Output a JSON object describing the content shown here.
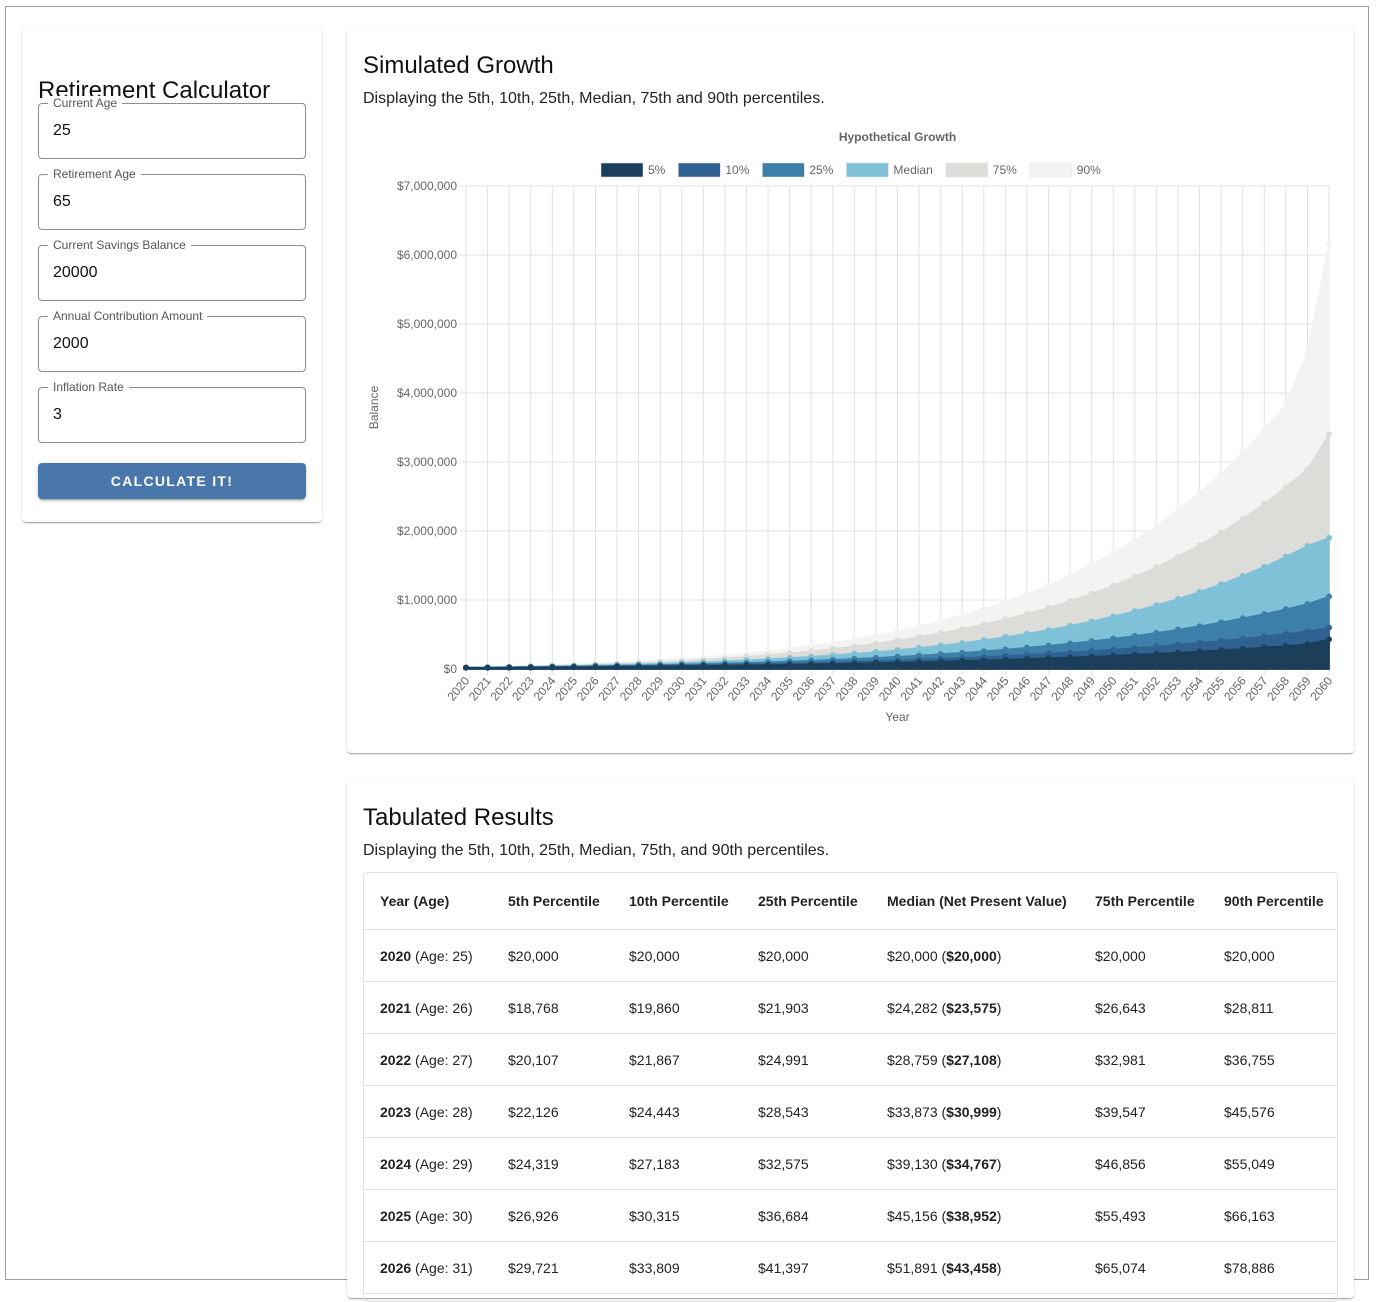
{
  "form": {
    "title": "Retirement Calculator",
    "fields": [
      {
        "label": "Current Age",
        "value": "25"
      },
      {
        "label": "Retirement Age",
        "value": "65"
      },
      {
        "label": "Current Savings Balance",
        "value": "20000"
      },
      {
        "label": "Annual Contribution Amount",
        "value": "2000"
      },
      {
        "label": "Inflation Rate",
        "value": "3"
      }
    ],
    "button_label": "CALCULATE IT!"
  },
  "growth": {
    "title": "Simulated Growth",
    "subtitle": "Displaying the 5th, 10th, 25th, Median, 75th and 90th percentiles."
  },
  "results": {
    "title": "Tabulated Results",
    "subtitle": "Displaying the 5th, 10th, 25th, Median, 75th, and 90th percentiles.",
    "columns": [
      "Year (Age)",
      "5th Percentile",
      "10th Percentile",
      "25th Percentile",
      "Median (Net Present Value)",
      "75th Percentile",
      "90th Percentile"
    ],
    "rows": [
      {
        "year": "2020",
        "age": "(Age: 25)",
        "p5": "$20,000",
        "p10": "$20,000",
        "p25": "$20,000",
        "median": "$20,000",
        "npv": "$20,000",
        "p75": "$20,000",
        "p90": "$20,000"
      },
      {
        "year": "2021",
        "age": "(Age: 26)",
        "p5": "$18,768",
        "p10": "$19,860",
        "p25": "$21,903",
        "median": "$24,282",
        "npv": "$23,575",
        "p75": "$26,643",
        "p90": "$28,811"
      },
      {
        "year": "2022",
        "age": "(Age: 27)",
        "p5": "$20,107",
        "p10": "$21,867",
        "p25": "$24,991",
        "median": "$28,759",
        "npv": "$27,108",
        "p75": "$32,981",
        "p90": "$36,755"
      },
      {
        "year": "2023",
        "age": "(Age: 28)",
        "p5": "$22,126",
        "p10": "$24,443",
        "p25": "$28,543",
        "median": "$33,873",
        "npv": "$30,999",
        "p75": "$39,547",
        "p90": "$45,576"
      },
      {
        "year": "2024",
        "age": "(Age: 29)",
        "p5": "$24,319",
        "p10": "$27,183",
        "p25": "$32,575",
        "median": "$39,130",
        "npv": "$34,767",
        "p75": "$46,856",
        "p90": "$55,049"
      },
      {
        "year": "2025",
        "age": "(Age: 30)",
        "p5": "$26,926",
        "p10": "$30,315",
        "p25": "$36,684",
        "median": "$45,156",
        "npv": "$38,952",
        "p75": "$55,493",
        "p90": "$66,163"
      },
      {
        "year": "2026",
        "age": "(Age: 31)",
        "p5": "$29,721",
        "p10": "$33,809",
        "p25": "$41,397",
        "median": "$51,891",
        "npv": "$43,458",
        "p75": "$65,074",
        "p90": "$78,886"
      }
    ]
  },
  "chart_data": {
    "type": "area",
    "title": "Hypothetical Growth",
    "xlabel": "Year",
    "ylabel": "Balance",
    "y_ticks": [
      "$0",
      "$1,000,000",
      "$2,000,000",
      "$3,000,000",
      "$4,000,000",
      "$5,000,000",
      "$6,000,000",
      "$7,000,000"
    ],
    "ylim": [
      0,
      7000000
    ],
    "grid": true,
    "legend_position": "top",
    "x": [
      "2020",
      "2021",
      "2022",
      "2023",
      "2024",
      "2025",
      "2026",
      "2027",
      "2028",
      "2029",
      "2030",
      "2031",
      "2032",
      "2033",
      "2034",
      "2035",
      "2036",
      "2037",
      "2038",
      "2039",
      "2040",
      "2041",
      "2042",
      "2043",
      "2044",
      "2045",
      "2046",
      "2047",
      "2048",
      "2049",
      "2050",
      "2051",
      "2052",
      "2053",
      "2054",
      "2055",
      "2056",
      "2057",
      "2058",
      "2059",
      "2060"
    ],
    "series": [
      {
        "name": "5%",
        "color": "#1b3f5a",
        "values": [
          20000,
          18768,
          20107,
          22126,
          24319,
          26926,
          29721,
          32500,
          35500,
          38700,
          42100,
          45800,
          49800,
          54000,
          58600,
          63500,
          68800,
          74400,
          80400,
          86800,
          93700,
          101000,
          109000,
          117000,
          126000,
          136000,
          146000,
          157000,
          168000,
          180000,
          193000,
          207000,
          222000,
          238000,
          255000,
          273000,
          292000,
          312000,
          334000,
          357000,
          430000
        ]
      },
      {
        "name": "10%",
        "color": "#2f6290",
        "values": [
          20000,
          19860,
          21867,
          24443,
          27183,
          30315,
          33809,
          37500,
          41500,
          45800,
          50500,
          55500,
          61000,
          66900,
          73300,
          80200,
          87700,
          95800,
          104500,
          114000,
          124000,
          135000,
          147000,
          160000,
          174000,
          189000,
          205000,
          222000,
          240000,
          260000,
          281000,
          303000,
          327000,
          353000,
          380000,
          409000,
          440000,
          473000,
          508000,
          546000,
          600000
        ]
      },
      {
        "name": "25%",
        "color": "#3c7fa9",
        "values": [
          20000,
          21903,
          24991,
          28543,
          32575,
          36684,
          41397,
          46600,
          52300,
          58500,
          65300,
          72700,
          80800,
          89600,
          99200,
          110000,
          121000,
          134000,
          147000,
          162000,
          178000,
          196000,
          215000,
          236000,
          258000,
          283000,
          309000,
          338000,
          369000,
          403000,
          440000,
          480000,
          523000,
          570000,
          620000,
          675000,
          734000,
          797000,
          866000,
          940000,
          1050000
        ]
      },
      {
        "name": "Median",
        "color": "#7fc2d8",
        "values": [
          20000,
          24282,
          28759,
          33873,
          39130,
          45156,
          51891,
          59400,
          67800,
          77100,
          87400,
          99000,
          112000,
          126000,
          142000,
          159000,
          178000,
          199000,
          222000,
          247000,
          275000,
          306000,
          340000,
          377000,
          418000,
          463000,
          512000,
          566000,
          625000,
          690000,
          761000,
          839000,
          924000,
          1017000,
          1118000,
          1229000,
          1350000,
          1482000,
          1626000,
          1783000,
          1900000
        ]
      },
      {
        "name": "75%",
        "color": "#dcdcd8",
        "values": [
          20000,
          26643,
          32981,
          39547,
          46856,
          55493,
          65074,
          76000,
          88300,
          102000,
          118000,
          135000,
          155000,
          177000,
          201000,
          228000,
          258000,
          291000,
          328000,
          369000,
          414000,
          464000,
          519000,
          580000,
          647000,
          720000,
          801000,
          889000,
          986000,
          1093000,
          1209000,
          1337000,
          1477000,
          1629000,
          1796000,
          1979000,
          2178000,
          2396000,
          2634000,
          2893000,
          3400000
        ]
      },
      {
        "name": "90%",
        "color": "#f3f3f2",
        "values": [
          20000,
          28811,
          36755,
          45576,
          55049,
          66163,
          78886,
          93000,
          109000,
          127000,
          147000,
          170000,
          196000,
          225000,
          257000,
          293000,
          333000,
          378000,
          428000,
          484000,
          546000,
          615000,
          692000,
          777000,
          871000,
          975000,
          1090000,
          1217000,
          1357000,
          1511000,
          1681000,
          1868000,
          2075000,
          2302000,
          2552000,
          2828000,
          3132000,
          3467000,
          3836000,
          4600000,
          6150000
        ]
      }
    ]
  }
}
